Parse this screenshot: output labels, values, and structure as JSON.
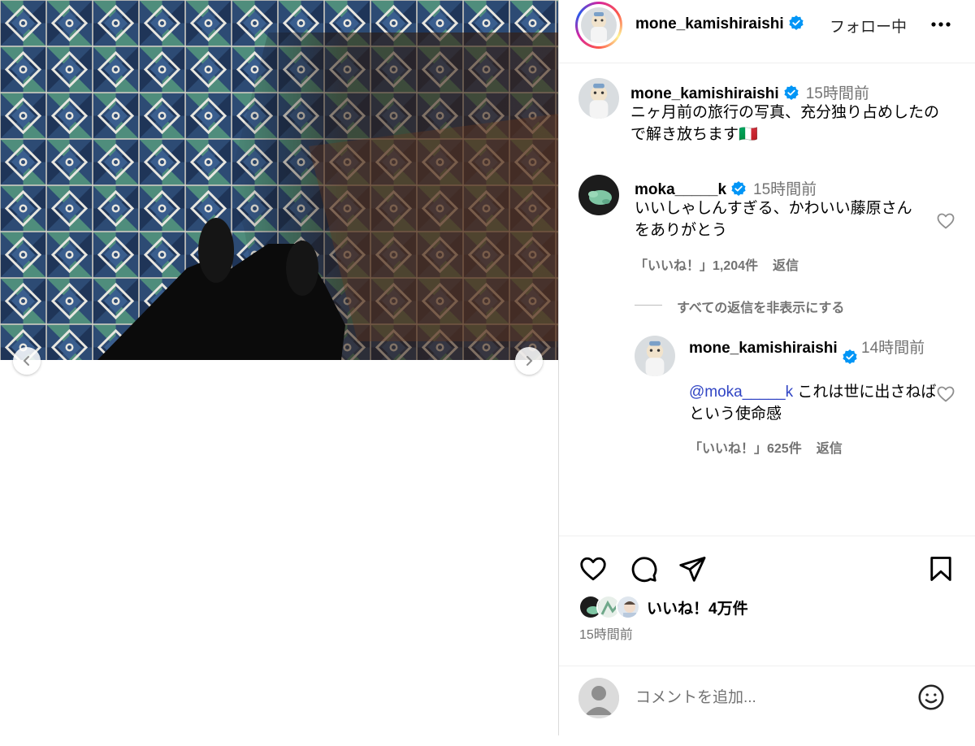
{
  "header": {
    "username": "mone_kamishiraishi",
    "follow_label": "フォロー中",
    "more_icon": "more-options-icon"
  },
  "caption": {
    "username": "mone_kamishiraishi",
    "time": "15時間前",
    "text": "ニヶ月前の旅行の写真、充分独り占めしたので解き放ちます🇮🇹"
  },
  "comments": [
    {
      "username": "moka_____k",
      "time": "15時間前",
      "text": "いいしゃしんすぎる、かわいい藤原さんをありがとう",
      "likes": "「いいね！」1,204件",
      "reply_label": "返信"
    }
  ],
  "replies_toggle": "すべての返信を非表示にする",
  "replies": [
    {
      "username": "mone_kamishiraishi",
      "time": "14時間前",
      "mention": "@moka_____k",
      "text": " これは世に出さねばという使命感",
      "likes": "「いいね！」625件",
      "reply_label": "返信"
    }
  ],
  "actions": {
    "like_icon": "heart-icon",
    "comment_icon": "comment-bubble-icon",
    "share_icon": "paper-plane-icon",
    "save_icon": "bookmark-icon"
  },
  "likes_summary": "いいね！4万件",
  "post_time": "15時間前",
  "comment_box": {
    "placeholder": "コメントを追加..."
  },
  "colors": {
    "verified": "#0095f6",
    "secondary_text": "#737373",
    "mention": "#3145c4",
    "tile_navy": "#25406a",
    "tile_green": "#4f8d7c"
  }
}
